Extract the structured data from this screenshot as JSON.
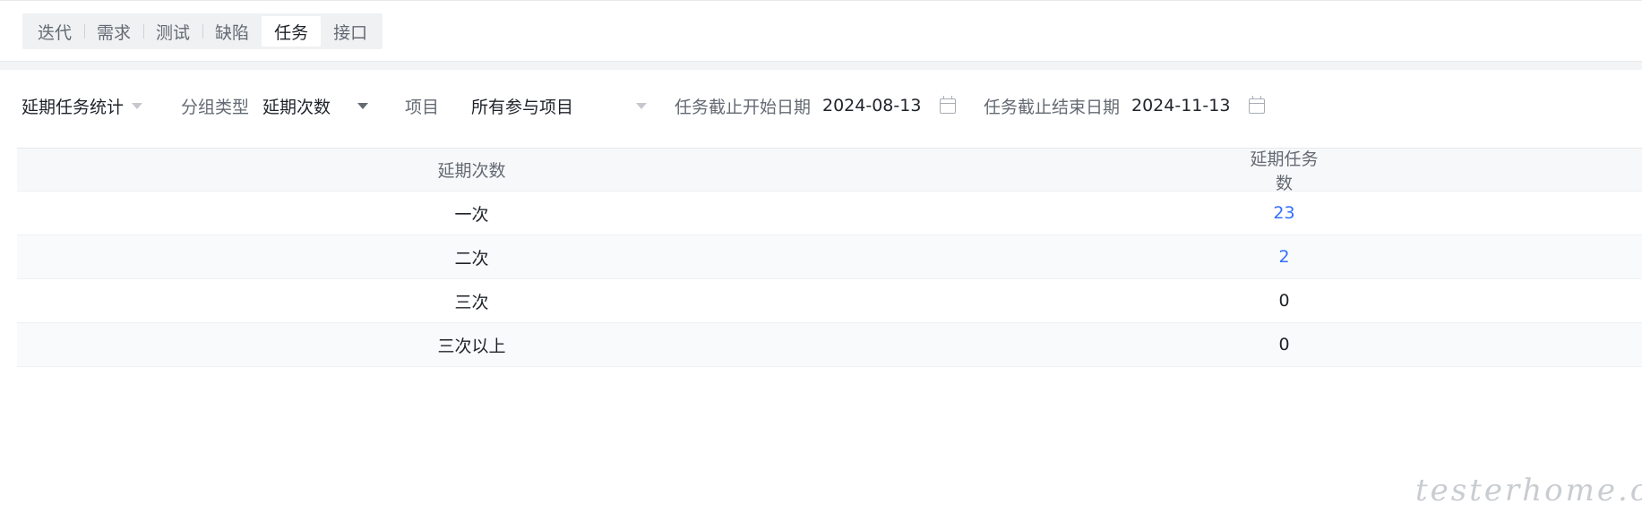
{
  "tabs": [
    {
      "label": "迭代",
      "active": false
    },
    {
      "label": "需求",
      "active": false
    },
    {
      "label": "测试",
      "active": false
    },
    {
      "label": "缺陷",
      "active": false
    },
    {
      "label": "任务",
      "active": true
    },
    {
      "label": "接口",
      "active": false
    }
  ],
  "filters": {
    "report_select": "延期任务统计",
    "group_type_label": "分组类型",
    "group_type_value": "延期次数",
    "project_label": "项目",
    "project_value": "所有参与项目",
    "start_date_label": "任务截止开始日期",
    "start_date_value": "2024-08-13",
    "end_date_label": "任务截止结束日期",
    "end_date_value": "2024-11-13"
  },
  "table": {
    "columns": [
      "延期次数",
      "延期任务数"
    ],
    "rows": [
      {
        "label": "一次",
        "count": "23"
      },
      {
        "label": "二次",
        "count": "2"
      },
      {
        "label": "三次",
        "count": "0"
      },
      {
        "label": "三次以上",
        "count": "0"
      }
    ]
  },
  "watermark": "testerhome.com",
  "colors": {
    "accent": "#3370ff",
    "header_bg": "#f7f8fa",
    "tab_bg": "#eff1f3"
  }
}
